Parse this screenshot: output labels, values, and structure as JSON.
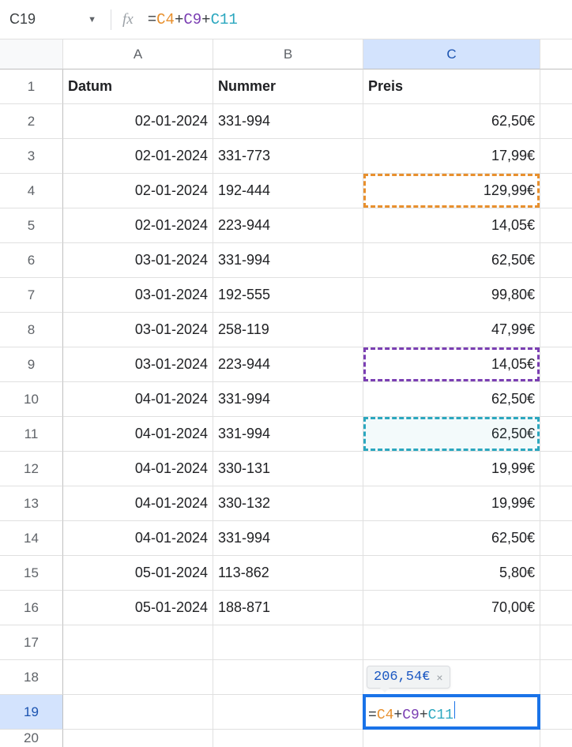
{
  "name_box": {
    "value": "C19"
  },
  "formula_bar": {
    "prefix": "=",
    "ref1": "C4",
    "plus": "+",
    "ref2": "C9",
    "ref3": "C11"
  },
  "columns": [
    "A",
    "B",
    "C"
  ],
  "selected_column_index": 2,
  "headers": {
    "A": "Datum",
    "B": "Nummer",
    "C": "Preis"
  },
  "rows": [
    {
      "n": 1
    },
    {
      "n": 2,
      "A": "02-01-2024",
      "B": "331-994",
      "C": "62,50€"
    },
    {
      "n": 3,
      "A": "02-01-2024",
      "B": "331-773",
      "C": "17,99€"
    },
    {
      "n": 4,
      "A": "02-01-2024",
      "B": "192-444",
      "C": "129,99€",
      "hi": "orange"
    },
    {
      "n": 5,
      "A": "02-01-2024",
      "B": "223-944",
      "C": "14,05€"
    },
    {
      "n": 6,
      "A": "03-01-2024",
      "B": "331-994",
      "C": "62,50€"
    },
    {
      "n": 7,
      "A": "03-01-2024",
      "B": "192-555",
      "C": "99,80€"
    },
    {
      "n": 8,
      "A": "03-01-2024",
      "B": "258-119",
      "C": "47,99€"
    },
    {
      "n": 9,
      "A": "03-01-2024",
      "B": "223-944",
      "C": "14,05€",
      "hi": "purple"
    },
    {
      "n": 10,
      "A": "04-01-2024",
      "B": "331-994",
      "C": "62,50€"
    },
    {
      "n": 11,
      "A": "04-01-2024",
      "B": "331-994",
      "C": "62,50€",
      "hi": "teal"
    },
    {
      "n": 12,
      "A": "04-01-2024",
      "B": "330-131",
      "C": "19,99€"
    },
    {
      "n": 13,
      "A": "04-01-2024",
      "B": "330-132",
      "C": "19,99€"
    },
    {
      "n": 14,
      "A": "04-01-2024",
      "B": "331-994",
      "C": "62,50€"
    },
    {
      "n": 15,
      "A": "05-01-2024",
      "B": "113-862",
      "C": "5,80€"
    },
    {
      "n": 16,
      "A": "05-01-2024",
      "B": "188-871",
      "C": "70,00€"
    },
    {
      "n": 17
    },
    {
      "n": 18
    },
    {
      "n": 19,
      "active": true
    },
    {
      "n": 20,
      "short": true
    }
  ],
  "active_cell": {
    "preview": "206,54€",
    "text_prefix": "=",
    "ref1": "C4",
    "plus": "+",
    "ref2": "C9",
    "ref3": "C11"
  }
}
